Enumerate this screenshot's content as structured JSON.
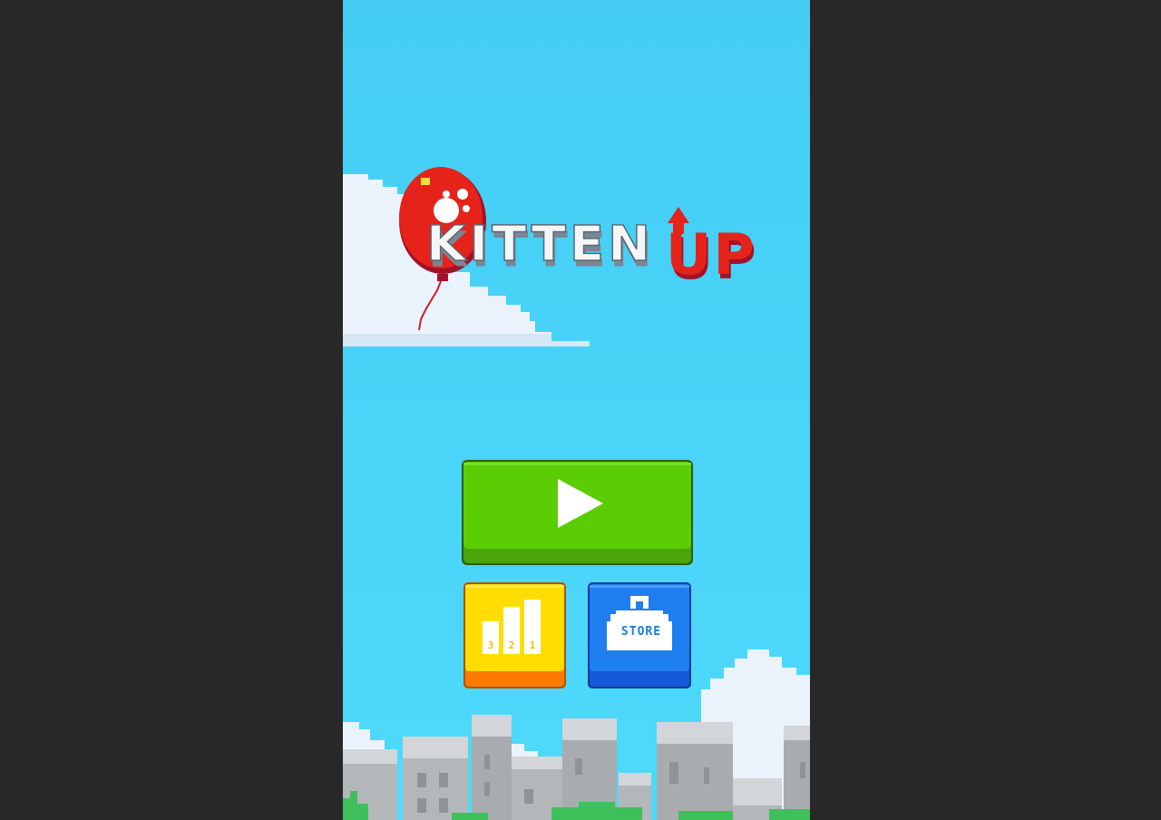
{
  "game": {
    "title_main": "KITTEN",
    "title_accent": "UP"
  },
  "buttons": {
    "play_icon": "play-icon",
    "leaderboard_icon": "podium-icon",
    "leaderboard_ranks": [
      "3",
      "2",
      "1"
    ],
    "store_icon": "shopping-bag-icon",
    "store_label": "STORE"
  },
  "colors": {
    "backdrop": "#282828",
    "sky": "#47d1f7",
    "play_green": "#5acd05",
    "leaderboard_yellow": "#ffdd00",
    "leaderboard_orange": "#ff7a00",
    "store_blue": "#1f7ff0",
    "balloon_red": "#e5231a"
  }
}
